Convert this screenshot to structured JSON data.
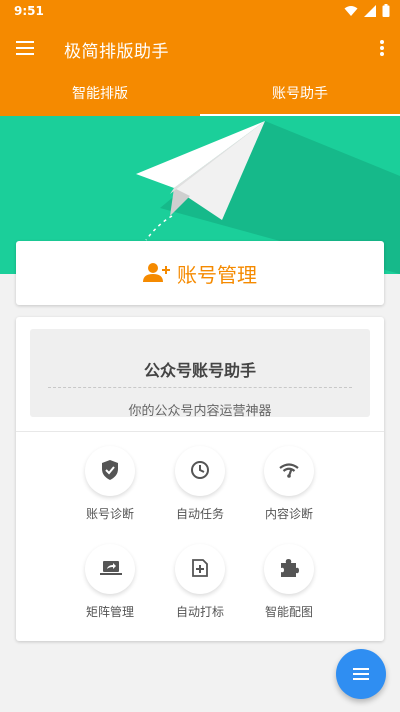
{
  "status_bar": {
    "time": "9:51"
  },
  "app_bar": {
    "title": "极简排版助手",
    "menu_icon": "hamburger-menu-icon",
    "overflow_icon": "more-vert-icon"
  },
  "tabs": [
    {
      "label": "智能排版",
      "selected": false
    },
    {
      "label": "账号助手",
      "selected": true
    }
  ],
  "colors": {
    "brand": "#f58a00",
    "hero": "#1bcf9a",
    "fab": "#2f8ef2"
  },
  "account_section": {
    "title": "账号管理",
    "icon": "manage-accounts-icon"
  },
  "banner": {
    "title": "公众号账号助手",
    "subtitle": "你的公众号内容运营神器"
  },
  "tools": [
    {
      "label": "账号诊断",
      "icon": "verified-shield-icon"
    },
    {
      "label": "自动任务",
      "icon": "clock-icon"
    },
    {
      "label": "内容诊断",
      "icon": "signal-wave-icon"
    },
    {
      "label": "矩阵管理",
      "icon": "laptop-share-icon"
    },
    {
      "label": "自动打标",
      "icon": "add-note-icon"
    },
    {
      "label": "智能配图",
      "icon": "puzzle-icon"
    }
  ],
  "fab": {
    "icon": "list-menu-icon"
  }
}
